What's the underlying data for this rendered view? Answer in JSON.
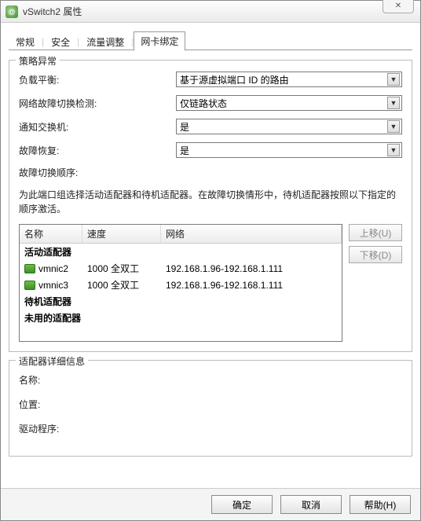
{
  "window": {
    "title": "vSwitch2 属性"
  },
  "tabs": [
    "常规",
    "安全",
    "流量调整",
    "网卡绑定"
  ],
  "activeTabIndex": 3,
  "policy": {
    "legend": "策略异常",
    "loadBalancing": {
      "label": "负载平衡:",
      "value": "基于源虚拟端口 ID 的路由"
    },
    "failoverDetection": {
      "label": "网络故障切换检测:",
      "value": "仅链路状态"
    },
    "notifySwitches": {
      "label": "通知交换机:",
      "value": "是"
    },
    "failback": {
      "label": "故障恢复:",
      "value": "是"
    },
    "orderLabel": "故障切换顺序:",
    "instruction": "为此端口组选择活动适配器和待机适配器。在故障切换情形中，待机适配器按照以下指定的顺序激活。",
    "columns": {
      "name": "名称",
      "speed": "速度",
      "network": "网络"
    },
    "groups": {
      "active": "活动适配器",
      "standby": "待机适配器",
      "unused": "未用的适配器"
    },
    "adapters": [
      {
        "name": "vmnic2",
        "speed": "1000 全双工",
        "network": "192.168.1.96-192.168.1.111"
      },
      {
        "name": "vmnic3",
        "speed": "1000 全双工",
        "network": "192.168.1.96-192.168.1.111"
      }
    ],
    "buttons": {
      "moveUp": "上移(U)",
      "moveDown": "下移(D)"
    }
  },
  "details": {
    "legend": "适配器详细信息",
    "name": "名称:",
    "location": "位置:",
    "driver": "驱动程序:"
  },
  "footer": {
    "ok": "确定",
    "cancel": "取消",
    "help": "帮助(H)"
  }
}
